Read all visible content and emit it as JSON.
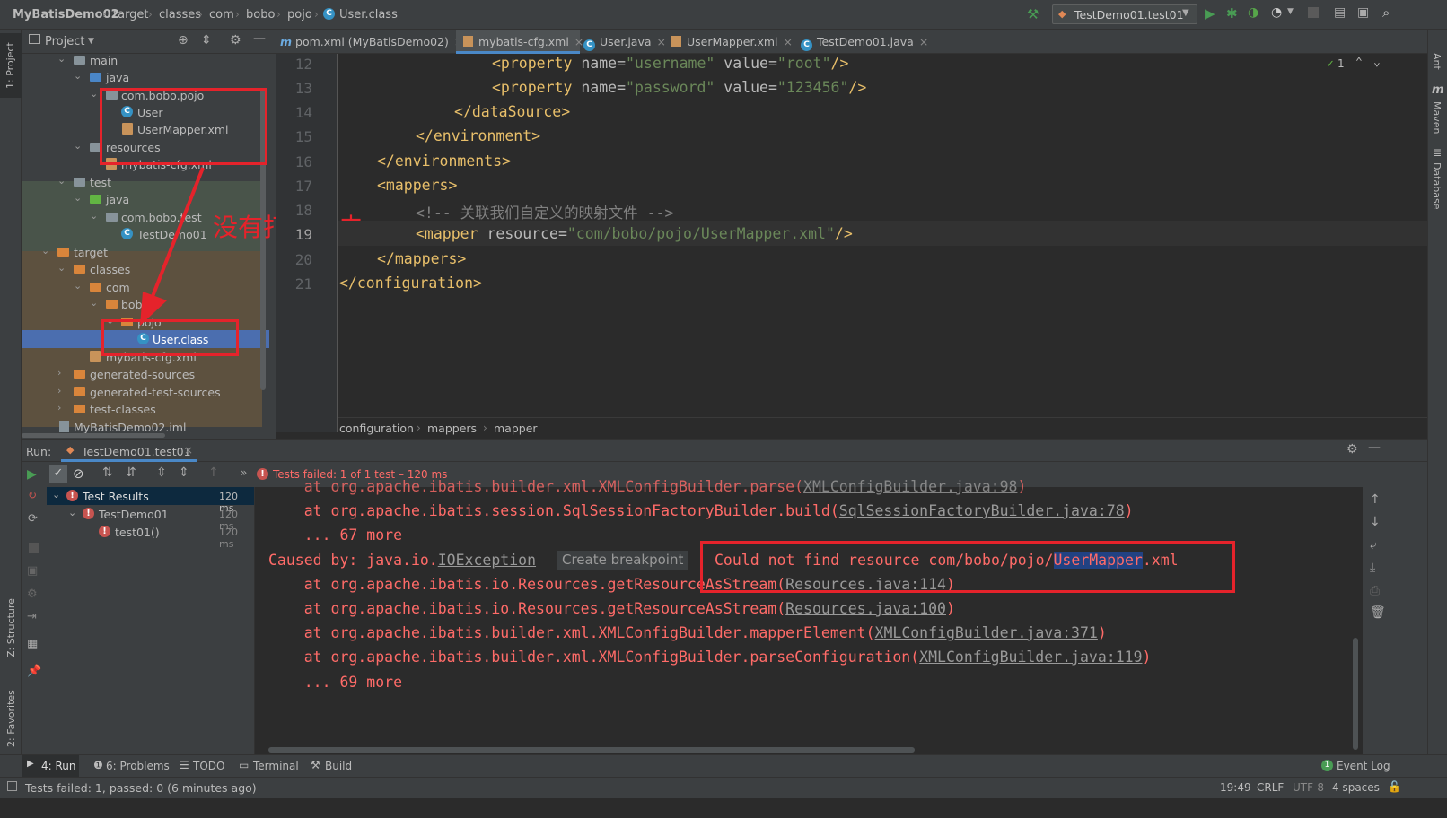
{
  "breadcrumbs": [
    "MyBatisDemo02",
    "target",
    "classes",
    "com",
    "bobo",
    "pojo",
    "User.class"
  ],
  "run_config": "TestDemo01.test01",
  "left_stripe": {
    "project": "1: Project",
    "structure": "Z: Structure",
    "favorites": "2: Favorites"
  },
  "right_stripe": {
    "ant": "Ant",
    "maven": "Maven",
    "database": "Database"
  },
  "project_panel": {
    "title": "Project",
    "tree": [
      {
        "label": "main",
        "type": "folder"
      },
      {
        "label": "java",
        "type": "src-folder"
      },
      {
        "label": "com.bobo.pojo",
        "type": "package"
      },
      {
        "label": "User",
        "type": "class"
      },
      {
        "label": "UserMapper.xml",
        "type": "xml"
      },
      {
        "label": "resources",
        "type": "res-folder"
      },
      {
        "label": "mybatis-cfg.xml",
        "type": "xml"
      },
      {
        "label": "test",
        "type": "folder"
      },
      {
        "label": "java",
        "type": "test-folder"
      },
      {
        "label": "com.bobo.test",
        "type": "package"
      },
      {
        "label": "TestDemo01",
        "type": "class"
      },
      {
        "label": "target",
        "type": "excluded-folder"
      },
      {
        "label": "classes",
        "type": "excluded-folder"
      },
      {
        "label": "com",
        "type": "excluded-folder"
      },
      {
        "label": "bobo",
        "type": "excluded-folder"
      },
      {
        "label": "pojo",
        "type": "excluded-folder"
      },
      {
        "label": "User.class",
        "type": "class"
      },
      {
        "label": "mybatis-cfg.xml",
        "type": "xml"
      },
      {
        "label": "generated-sources",
        "type": "excluded-folder"
      },
      {
        "label": "generated-test-sources",
        "type": "excluded-folder"
      },
      {
        "label": "test-classes",
        "type": "excluded-folder"
      },
      {
        "label": "MyBatisDemo02.iml",
        "type": "iml"
      }
    ]
  },
  "annotation": "没有打包进去",
  "editor_tabs": [
    "pom.xml (MyBatisDemo02)",
    "mybatis-cfg.xml",
    "User.java",
    "UserMapper.xml",
    "TestDemo01.java"
  ],
  "editor": {
    "line_numbers": [
      "12",
      "13",
      "14",
      "15",
      "16",
      "17",
      "18",
      "19",
      "20",
      "21"
    ],
    "inspection_count": "1",
    "code": {
      "l12": {
        "tag_open": "<property ",
        "a1": "name=",
        "v1": "\"username\"",
        "a2": " value=",
        "v2": "\"root\"",
        "tag_close": "/>"
      },
      "l13": {
        "tag_open": "<property ",
        "a1": "name=",
        "v1": "\"password\"",
        "a2": " value=",
        "v2": "\"123456\"",
        "tag_close": "/>"
      },
      "l14": "</dataSource>",
      "l15": "</environment>",
      "l16": "</environments>",
      "l17": "<mappers>",
      "l18": "<!-- 关联我们自定义的映射文件 -->",
      "l19": {
        "tag_open": "<mapper ",
        "a1": "resource=",
        "v1": "\"com/bobo/pojo/UserMapper.xml\"",
        "tag_close": "/>"
      },
      "l20": "</mappers>",
      "l21": "</configuration>"
    },
    "breadcrumbs": [
      "configuration",
      "mappers",
      "mapper"
    ]
  },
  "run_panel": {
    "label": "Run:",
    "tab": "TestDemo01.test01",
    "status": "Tests failed: 1 of 1 test – 120 ms",
    "tree": [
      {
        "label": "Test Results",
        "time": "120 ms"
      },
      {
        "label": "TestDemo01",
        "time": "120 ms"
      },
      {
        "label": "test01()",
        "time": "120 ms"
      }
    ],
    "console": {
      "l0": {
        "pre": "    at org.apache.ibatis.builder.xml.XMLConfigBuilder.parse(",
        "link": "XMLConfigBuilder.java:98",
        "post": ")"
      },
      "l1": {
        "pre": "    at org.apache.ibatis.session.SqlSessionFactoryBuilder.build(",
        "link": "SqlSessionFactoryBuilder.java:78",
        "post": ")"
      },
      "l2": "    ... 67 more",
      "l3": {
        "pre": "Caused by: java.io.",
        "link": "IOException",
        "tooltip": "Create breakpoint",
        "msg_pre": "Could not find resource com/bobo/pojo/",
        "msg_sel": "UserMapper",
        "msg_post": ".xml"
      },
      "l4": {
        "pre": "    at org.apache.ibatis.io.Resources.getResourceAsStream(",
        "link": "Resources.java:114",
        "post": ")"
      },
      "l5": {
        "pre": "    at org.apache.ibatis.io.Resources.getResourceAsStream(",
        "link": "Resources.java:100",
        "post": ")"
      },
      "l6": {
        "pre": "    at org.apache.ibatis.builder.xml.XMLConfigBuilder.mapperElement(",
        "link": "XMLConfigBuilder.java:371",
        "post": ")"
      },
      "l7": {
        "pre": "    at org.apache.ibatis.builder.xml.XMLConfigBuilder.parseConfiguration(",
        "link": "XMLConfigBuilder.java:119",
        "post": ")"
      },
      "l8": "    ... 69 more"
    }
  },
  "bottom_tools": [
    "4: Run",
    "6: Problems",
    "TODO",
    "Terminal",
    "Build"
  ],
  "event_log": "Event Log",
  "event_log_count": "1",
  "status_bar": {
    "message": "Tests failed: 1, passed: 0 (6 minutes ago)",
    "position": "19:49",
    "line_sep": "CRLF",
    "encoding": "UTF-8",
    "indent": "4 spaces"
  },
  "colors": {
    "accent": "#4b6eaf",
    "error": "#ff6b68",
    "annotation": "#e5232b",
    "run_green": "#499c54"
  }
}
